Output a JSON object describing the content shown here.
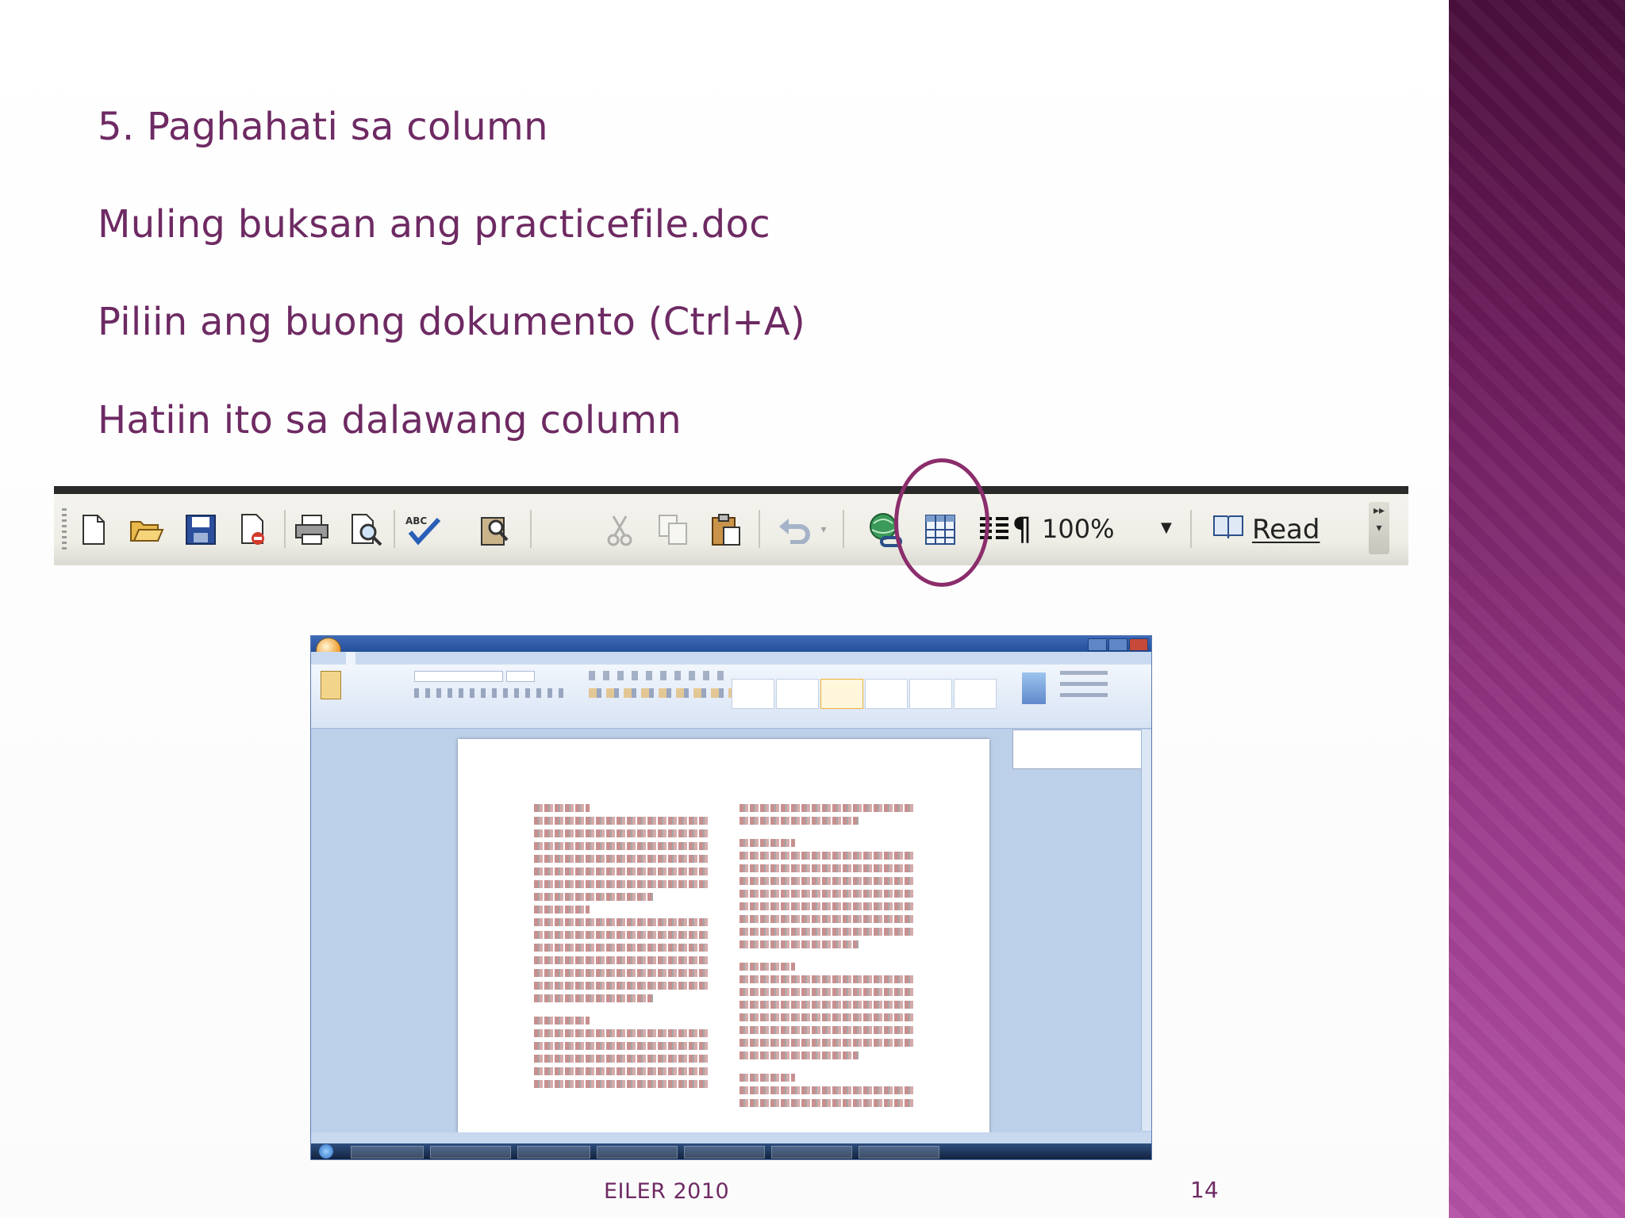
{
  "slide": {
    "lines": [
      "5. Paghahati sa column",
      "Muling buksan ang practicefile.doc",
      "Piliin ang buong dokumento (Ctrl+A)",
      "Hatiin ito sa dalawang column"
    ],
    "footer": "EILER 2010",
    "page_number": "14"
  },
  "toolbar": {
    "zoom_value": "100%",
    "read_label": "Read",
    "pilcrow": "¶",
    "icons": [
      "new-document-icon",
      "open-folder-icon",
      "save-icon",
      "permission-icon",
      "print-icon",
      "print-preview-icon",
      "spelling-icon",
      "research-icon",
      "cut-icon",
      "copy-icon",
      "paste-icon",
      "undo-icon",
      "hyperlink-icon",
      "table-icon",
      "columns-icon",
      "show-formatting-icon",
      "read-icon"
    ]
  },
  "colors": {
    "text_purple": "#6e2a63",
    "highlight_circle": "#8b2d6c",
    "side_band_top": "#4a0f3c",
    "side_band_bottom": "#b552a6"
  }
}
